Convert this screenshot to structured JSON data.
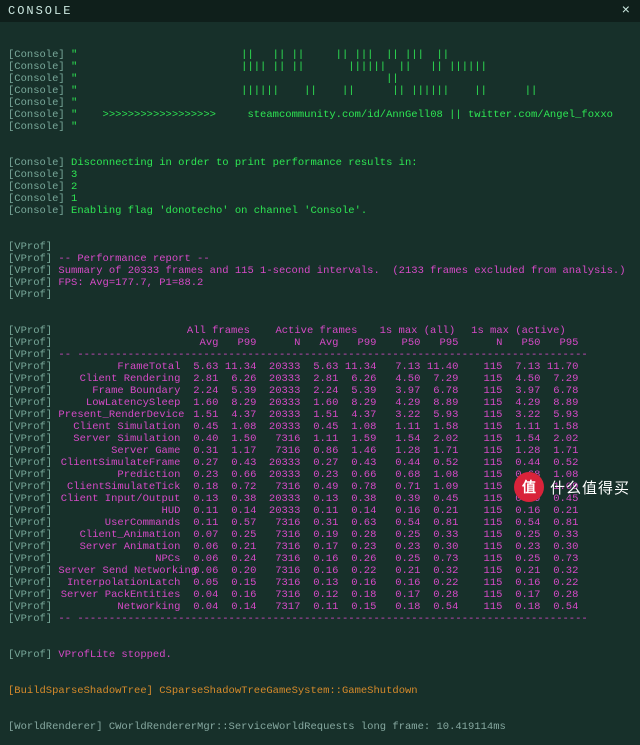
{
  "title": "CONSOLE",
  "tags": {
    "console": "[Console]",
    "vprof": "[VProf]",
    "build": "[BuildSparseShadowTree]",
    "world": "[WorldRenderer]"
  },
  "ascii": [
    "\"                          ||   || ||     || |||  || |||  || ",
    "\"                          |||| || ||       ||||||  ||   || |||||| ",
    "\"                                                 ||       ",
    "\"                          ||||||    ||    ||      || ||||||    ||      || ",
    "\"",
    "\"    >>>>>>>>>>>>>>>>>>     steamcommunity.com/id/AnnGell08 || twitter.com/Angel_foxxo     <<<<<<<",
    "\""
  ],
  "consoleLines": [
    "Disconnecting in order to print performance results in:",
    "3",
    "2",
    "1",
    "Enabling flag 'donotecho' on channel 'Console'."
  ],
  "vprofLines": [
    "",
    "-- Performance report --",
    "Summary of 20333 frames and 115 1-second intervals.  (2133 frames excluded from analysis.)",
    "FPS: Avg=177.7, P1=88.2",
    ""
  ],
  "dash": "-- ---------------------------------------------------------------------------------",
  "groupHeaders": [
    "All frames",
    "Active frames",
    "1s max (all)",
    "1s max (active)"
  ],
  "colHeaders": [
    "",
    "Avg",
    "P99",
    "N",
    "Avg",
    "P99",
    "P50",
    "P95",
    "N",
    "P50",
    "P95"
  ],
  "rows": [
    {
      "label": "FrameTotal",
      "v": [
        "5.63",
        "11.34",
        "20333",
        "5.63",
        "11.34",
        "7.13",
        "11.40",
        "115",
        "7.13",
        "11.70"
      ]
    },
    {
      "label": "Client Rendering",
      "v": [
        "2.81",
        "6.26",
        "20333",
        "2.81",
        "6.26",
        "4.50",
        "7.29",
        "115",
        "4.50",
        "7.29"
      ]
    },
    {
      "label": "Frame Boundary",
      "v": [
        "2.24",
        "5.39",
        "20333",
        "2.24",
        "5.39",
        "3.97",
        "6.78",
        "115",
        "3.97",
        "6.78"
      ]
    },
    {
      "label": "LowLatencySleep",
      "v": [
        "1.60",
        "8.29",
        "20333",
        "1.60",
        "8.29",
        "4.29",
        "8.89",
        "115",
        "4.29",
        "8.89"
      ]
    },
    {
      "label": "Present_RenderDevice",
      "v": [
        "1.51",
        "4.37",
        "20333",
        "1.51",
        "4.37",
        "3.22",
        "5.93",
        "115",
        "3.22",
        "5.93"
      ]
    },
    {
      "label": "Client Simulation",
      "v": [
        "0.45",
        "1.08",
        "20333",
        "0.45",
        "1.08",
        "1.11",
        "1.58",
        "115",
        "1.11",
        "1.58"
      ]
    },
    {
      "label": "Server Simulation",
      "v": [
        "0.40",
        "1.50",
        "7316",
        "1.11",
        "1.59",
        "1.54",
        "2.02",
        "115",
        "1.54",
        "2.02"
      ]
    },
    {
      "label": "Server Game",
      "v": [
        "0.31",
        "1.17",
        "7316",
        "0.86",
        "1.46",
        "1.28",
        "1.71",
        "115",
        "1.28",
        "1.71"
      ]
    },
    {
      "label": "ClientSimulateFrame",
      "v": [
        "0.27",
        "0.43",
        "20333",
        "0.27",
        "0.43",
        "0.44",
        "0.52",
        "115",
        "0.44",
        "0.52"
      ]
    },
    {
      "label": "Prediction",
      "v": [
        "0.23",
        "0.66",
        "20333",
        "0.23",
        "0.66",
        "0.68",
        "1.08",
        "115",
        "0.68",
        "1.08"
      ]
    },
    {
      "label": "ClientSimulateTick",
      "v": [
        "0.18",
        "0.72",
        "7316",
        "0.49",
        "0.78",
        "0.71",
        "1.09",
        "115",
        "0.71",
        "1.09"
      ]
    },
    {
      "label": "Client Input/Output",
      "v": [
        "0.13",
        "0.38",
        "20333",
        "0.13",
        "0.38",
        "0.39",
        "0.45",
        "115",
        "0.39",
        "0.45"
      ]
    },
    {
      "label": "HUD",
      "v": [
        "0.11",
        "0.14",
        "20333",
        "0.11",
        "0.14",
        "0.16",
        "0.21",
        "115",
        "0.16",
        "0.21"
      ]
    },
    {
      "label": "UserCommands",
      "v": [
        "0.11",
        "0.57",
        "7316",
        "0.31",
        "0.63",
        "0.54",
        "0.81",
        "115",
        "0.54",
        "0.81"
      ]
    },
    {
      "label": "Client_Animation",
      "v": [
        "0.07",
        "0.25",
        "7316",
        "0.19",
        "0.28",
        "0.25",
        "0.33",
        "115",
        "0.25",
        "0.33"
      ]
    },
    {
      "label": "Server Animation",
      "v": [
        "0.06",
        "0.21",
        "7316",
        "0.17",
        "0.23",
        "0.23",
        "0.30",
        "115",
        "0.23",
        "0.30"
      ]
    },
    {
      "label": "NPCs",
      "v": [
        "0.06",
        "0.24",
        "7316",
        "0.16",
        "0.26",
        "0.25",
        "0.73",
        "115",
        "0.25",
        "0.73"
      ]
    },
    {
      "label": "Server Send Networking",
      "v": [
        "0.06",
        "0.20",
        "7316",
        "0.16",
        "0.22",
        "0.21",
        "0.32",
        "115",
        "0.21",
        "0.32"
      ]
    },
    {
      "label": "InterpolationLatch",
      "v": [
        "0.05",
        "0.15",
        "7316",
        "0.13",
        "0.16",
        "0.16",
        "0.22",
        "115",
        "0.16",
        "0.22"
      ]
    },
    {
      "label": "Server PackEntities",
      "v": [
        "0.04",
        "0.16",
        "7316",
        "0.12",
        "0.18",
        "0.17",
        "0.28",
        "115",
        "0.17",
        "0.28"
      ]
    },
    {
      "label": "Networking",
      "v": [
        "0.04",
        "0.14",
        "7317",
        "0.11",
        "0.15",
        "0.18",
        "0.54",
        "115",
        "0.18",
        "0.54"
      ]
    }
  ],
  "vprofStop": "VProfLite stopped.",
  "buildLine": "CSparseShadowTreeGameSystem::GameShutdown",
  "worldLine": "CWorldRendererMgr::ServiceWorldRequests long frame: 10.419114ms",
  "watermark": {
    "badge": "值",
    "text": "什么值得买"
  }
}
